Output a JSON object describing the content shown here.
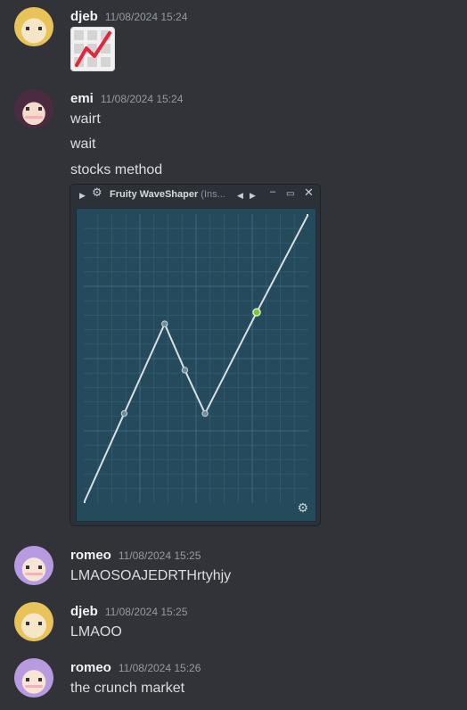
{
  "messages": [
    {
      "author": "djeb",
      "timestamp": "11/08/2024 15:24",
      "emoji": "chart-increasing-emoji"
    },
    {
      "author": "emi",
      "timestamp": "11/08/2024 15:24",
      "lines": [
        "wairt",
        "wait",
        "stocks method"
      ]
    },
    {
      "author": "romeo",
      "timestamp": "11/08/2024 15:25",
      "lines": [
        "LMAOSOAJEDRTHrtyhjy"
      ]
    },
    {
      "author": "djeb",
      "timestamp": "11/08/2024 15:25",
      "lines": [
        "LMAOO"
      ]
    },
    {
      "author": "romeo",
      "timestamp": "11/08/2024 15:26",
      "lines": [
        "the crunch market"
      ]
    }
  ],
  "plugin": {
    "title": "Fruity WaveShaper",
    "title_suffix": "(Ins...",
    "icons": [
      "play-arrow-icon",
      "gear-icon",
      "arrow-left-icon",
      "arrow-right-icon",
      "minimize-icon",
      "maximize-icon",
      "close-icon"
    ],
    "colors": {
      "background": "#244a5c",
      "curve": "#d9dfe3",
      "active_point": "#7cc43a"
    }
  },
  "chart_data": {
    "type": "line",
    "x": [
      0,
      0.18,
      0.36,
      0.45,
      0.54,
      0.77,
      1.0
    ],
    "y": [
      0,
      0.31,
      0.62,
      0.46,
      0.31,
      0.66,
      1.0
    ],
    "control_points": [
      0.18,
      0.36,
      0.45,
      0.54,
      0.77
    ],
    "active_point_index": 4,
    "xlim": [
      0,
      1
    ],
    "ylim": [
      0,
      1
    ],
    "grid": true
  }
}
